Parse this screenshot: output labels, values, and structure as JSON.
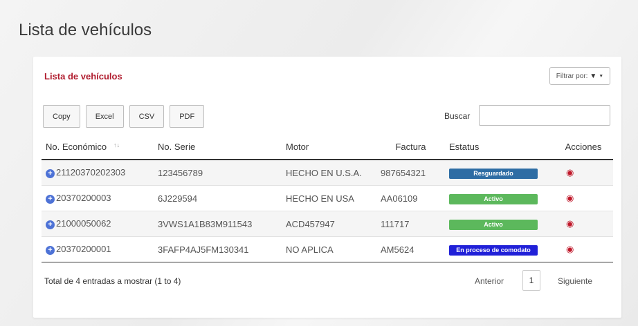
{
  "page": {
    "title": "Lista de vehículos"
  },
  "card": {
    "title": "Lista de vehículos",
    "filter_label": "Filtrar por:"
  },
  "toolbar": {
    "buttons": [
      "Copy",
      "Excel",
      "CSV",
      "PDF"
    ],
    "search_label": "Buscar",
    "search_value": ""
  },
  "table": {
    "columns": [
      "No. Económico",
      "No. Serie",
      "Motor",
      "Factura",
      "Estatus",
      "Acciones"
    ],
    "rows": [
      {
        "economico": "21120370202303",
        "serie": "123456789",
        "motor": "HECHO EN U.S.A.",
        "factura": "987654321",
        "estatus": "Resguardado",
        "estatus_color": "#2e6da4"
      },
      {
        "economico": "20370200003",
        "serie": "6J229594",
        "motor": "HECHO EN USA",
        "factura": "AA06109",
        "estatus": "Activo",
        "estatus_color": "#5cb85c"
      },
      {
        "economico": "21000050062",
        "serie": "3VWS1A1B83M911543",
        "motor": "ACD457947",
        "factura": "111717",
        "estatus": "Activo",
        "estatus_color": "#5cb85c"
      },
      {
        "economico": "20370200001",
        "serie": "3FAFP4AJ5FM130341",
        "motor": "NO APLICA",
        "factura": "AM5624",
        "estatus": "En proceso de comodato",
        "estatus_color": "#2020d8"
      }
    ]
  },
  "footer": {
    "summary": "Total de 4 entradas a mostrar (1 to 4)",
    "prev_label": "Anterior",
    "current_page": "1",
    "next_label": "Siguiente"
  },
  "colors": {
    "accent_title": "#b01c2e",
    "eye_icon": "#c0182a",
    "expand_icon": "#4d72d6"
  }
}
